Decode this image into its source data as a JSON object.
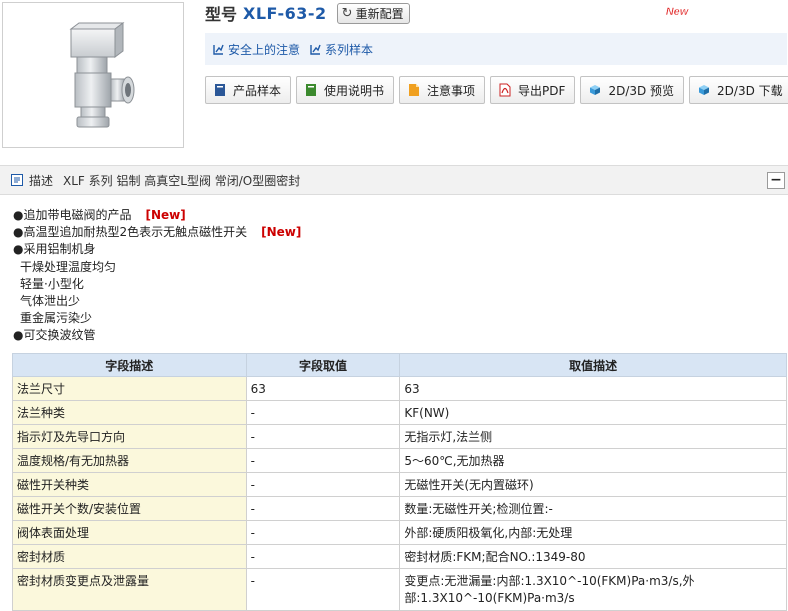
{
  "product": {
    "model_prefix": "型号",
    "model_code": "XLF-63-2",
    "reconfigure_label": "重新配置",
    "new_badge": "New"
  },
  "links": [
    {
      "label": "安全上的注意"
    },
    {
      "label": "系列样本"
    }
  ],
  "doc_buttons": [
    {
      "label": "产品样本",
      "icon": "catalog-icon",
      "color": "#2b5797"
    },
    {
      "label": "使用说明书",
      "icon": "manual-icon",
      "color": "#3c8a2e"
    },
    {
      "label": "注意事项",
      "icon": "caution-icon",
      "color": "#f0a020"
    },
    {
      "label": "导出PDF",
      "icon": "pdf-icon",
      "color": "#cc2222"
    },
    {
      "label": "2D/3D 预览",
      "icon": "cube-icon",
      "color": "#3a9ad9"
    },
    {
      "label": "2D/3D 下载",
      "icon": "cube-icon",
      "color": "#3a9ad9"
    }
  ],
  "description": {
    "heading": "描述",
    "subtitle": "XLF 系列 铝制 高真空L型阀 常闭/O型圈密封",
    "collapse_label": "−"
  },
  "features": [
    {
      "text": "●追加带电磁阀的产品",
      "tag": "[New]"
    },
    {
      "text": "●高温型追加耐热型2色表示无触点磁性开关",
      "tag": "[New]"
    },
    {
      "text": "●采用铝制机身"
    },
    {
      "text": "干燥处理温度均匀",
      "sub": true
    },
    {
      "text": "轻量·小型化",
      "sub": true
    },
    {
      "text": "气体泄出少",
      "sub": true
    },
    {
      "text": "重金属污染少",
      "sub": true
    },
    {
      "text": "●可交换波纹管"
    }
  ],
  "spec_table": {
    "headers": [
      "字段描述",
      "字段取值",
      "取值描述"
    ],
    "rows": [
      [
        "法兰尺寸",
        "63",
        "63"
      ],
      [
        "法兰种类",
        "-",
        "KF(NW)"
      ],
      [
        "指示灯及先导口方向",
        "-",
        "无指示灯,法兰侧"
      ],
      [
        "温度规格/有无加热器",
        "-",
        "5～60℃,无加热器"
      ],
      [
        "磁性开关种类",
        "-",
        "无磁性开关(无内置磁环)"
      ],
      [
        "磁性开关个数/安装位置",
        "-",
        "数量:无磁性开关;检测位置:-"
      ],
      [
        "阀体表面处理",
        "-",
        "外部:硬质阳极氧化,内部:无处理"
      ],
      [
        "密封材质",
        "-",
        "密封材质:FKM;配合NO.:1349-80"
      ],
      [
        "密封材质变更点及泄露量",
        "-",
        "变更点:无泄漏量:内部:1.3X10^-10(FKM)Pa·m3/s,外部:1.3X10^-10(FKM)Pa·m3/s"
      ]
    ]
  }
}
